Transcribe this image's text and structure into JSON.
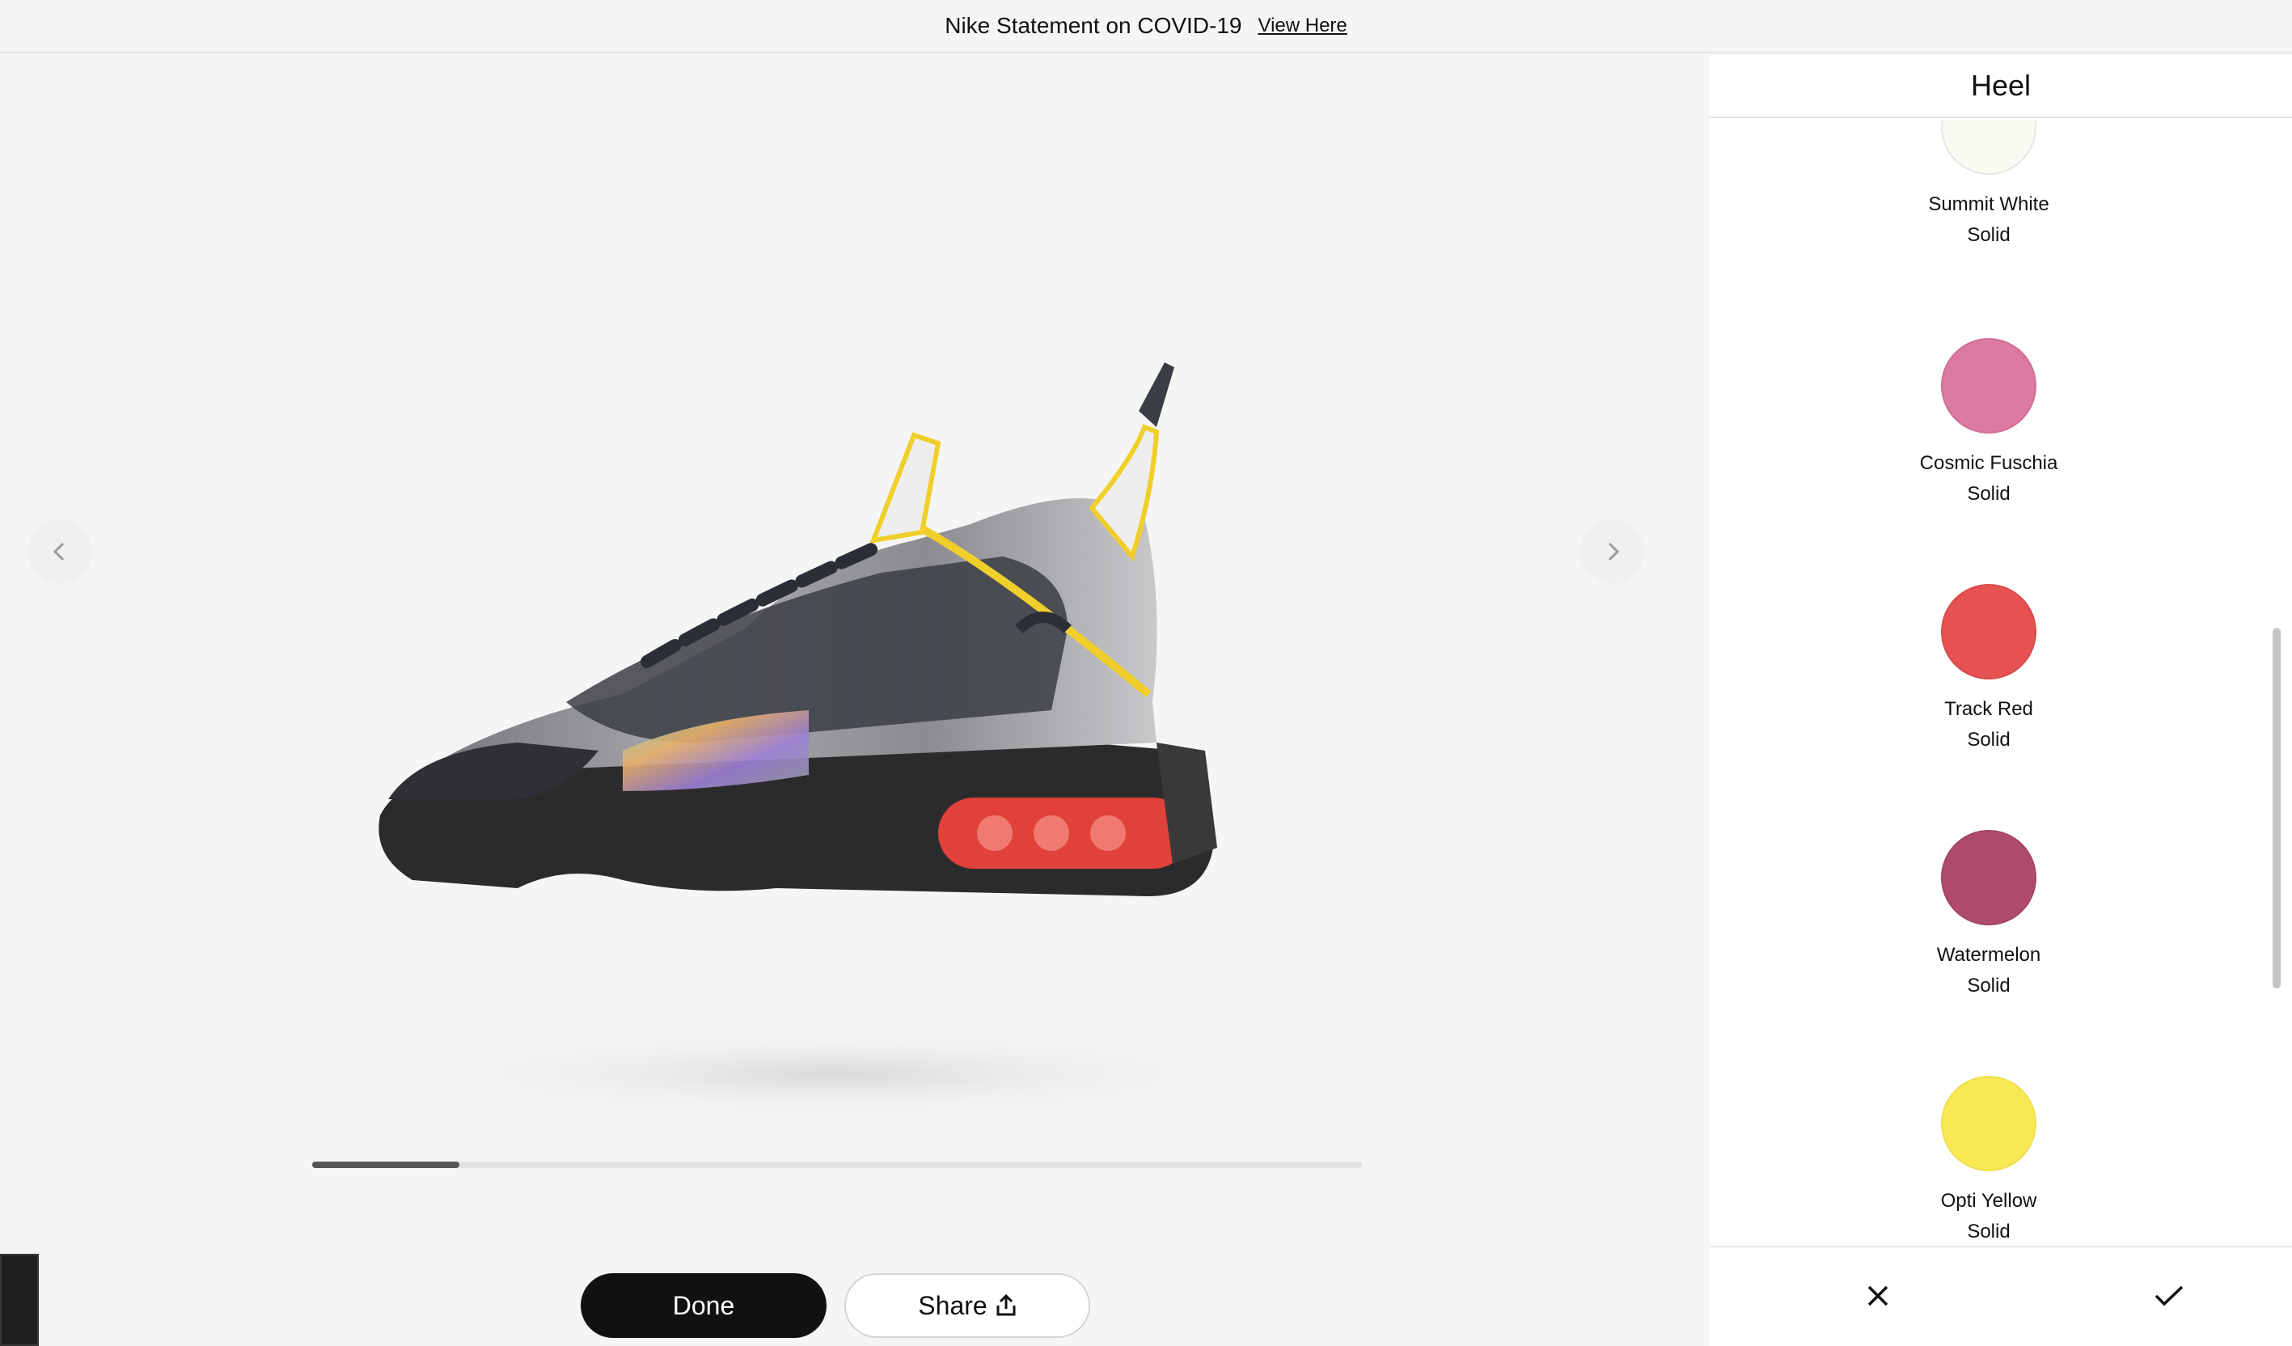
{
  "banner": {
    "text": "Nike Statement on COVID-19",
    "link_label": "View Here"
  },
  "viewer": {
    "done_label": "Done",
    "share_label": "Share",
    "progress_fraction": 0.14
  },
  "panel": {
    "title": "Heel",
    "swatches": [
      {
        "name": "Summit White",
        "type": "Solid",
        "color": "#fbfaf2"
      },
      {
        "name": "Cosmic Fuschia",
        "type": "Solid",
        "color": "#dc7aa1"
      },
      {
        "name": "Track Red",
        "type": "Solid",
        "color": "#e65252"
      },
      {
        "name": "Watermelon",
        "type": "Solid",
        "color": "#b04b70"
      },
      {
        "name": "Opti Yellow",
        "type": "Solid",
        "color": "#f9e854"
      }
    ]
  },
  "icons": {
    "prev": "chevron-left-icon",
    "next": "chevron-right-icon",
    "share": "share-icon",
    "cancel": "close-icon",
    "confirm": "checkmark-icon"
  }
}
